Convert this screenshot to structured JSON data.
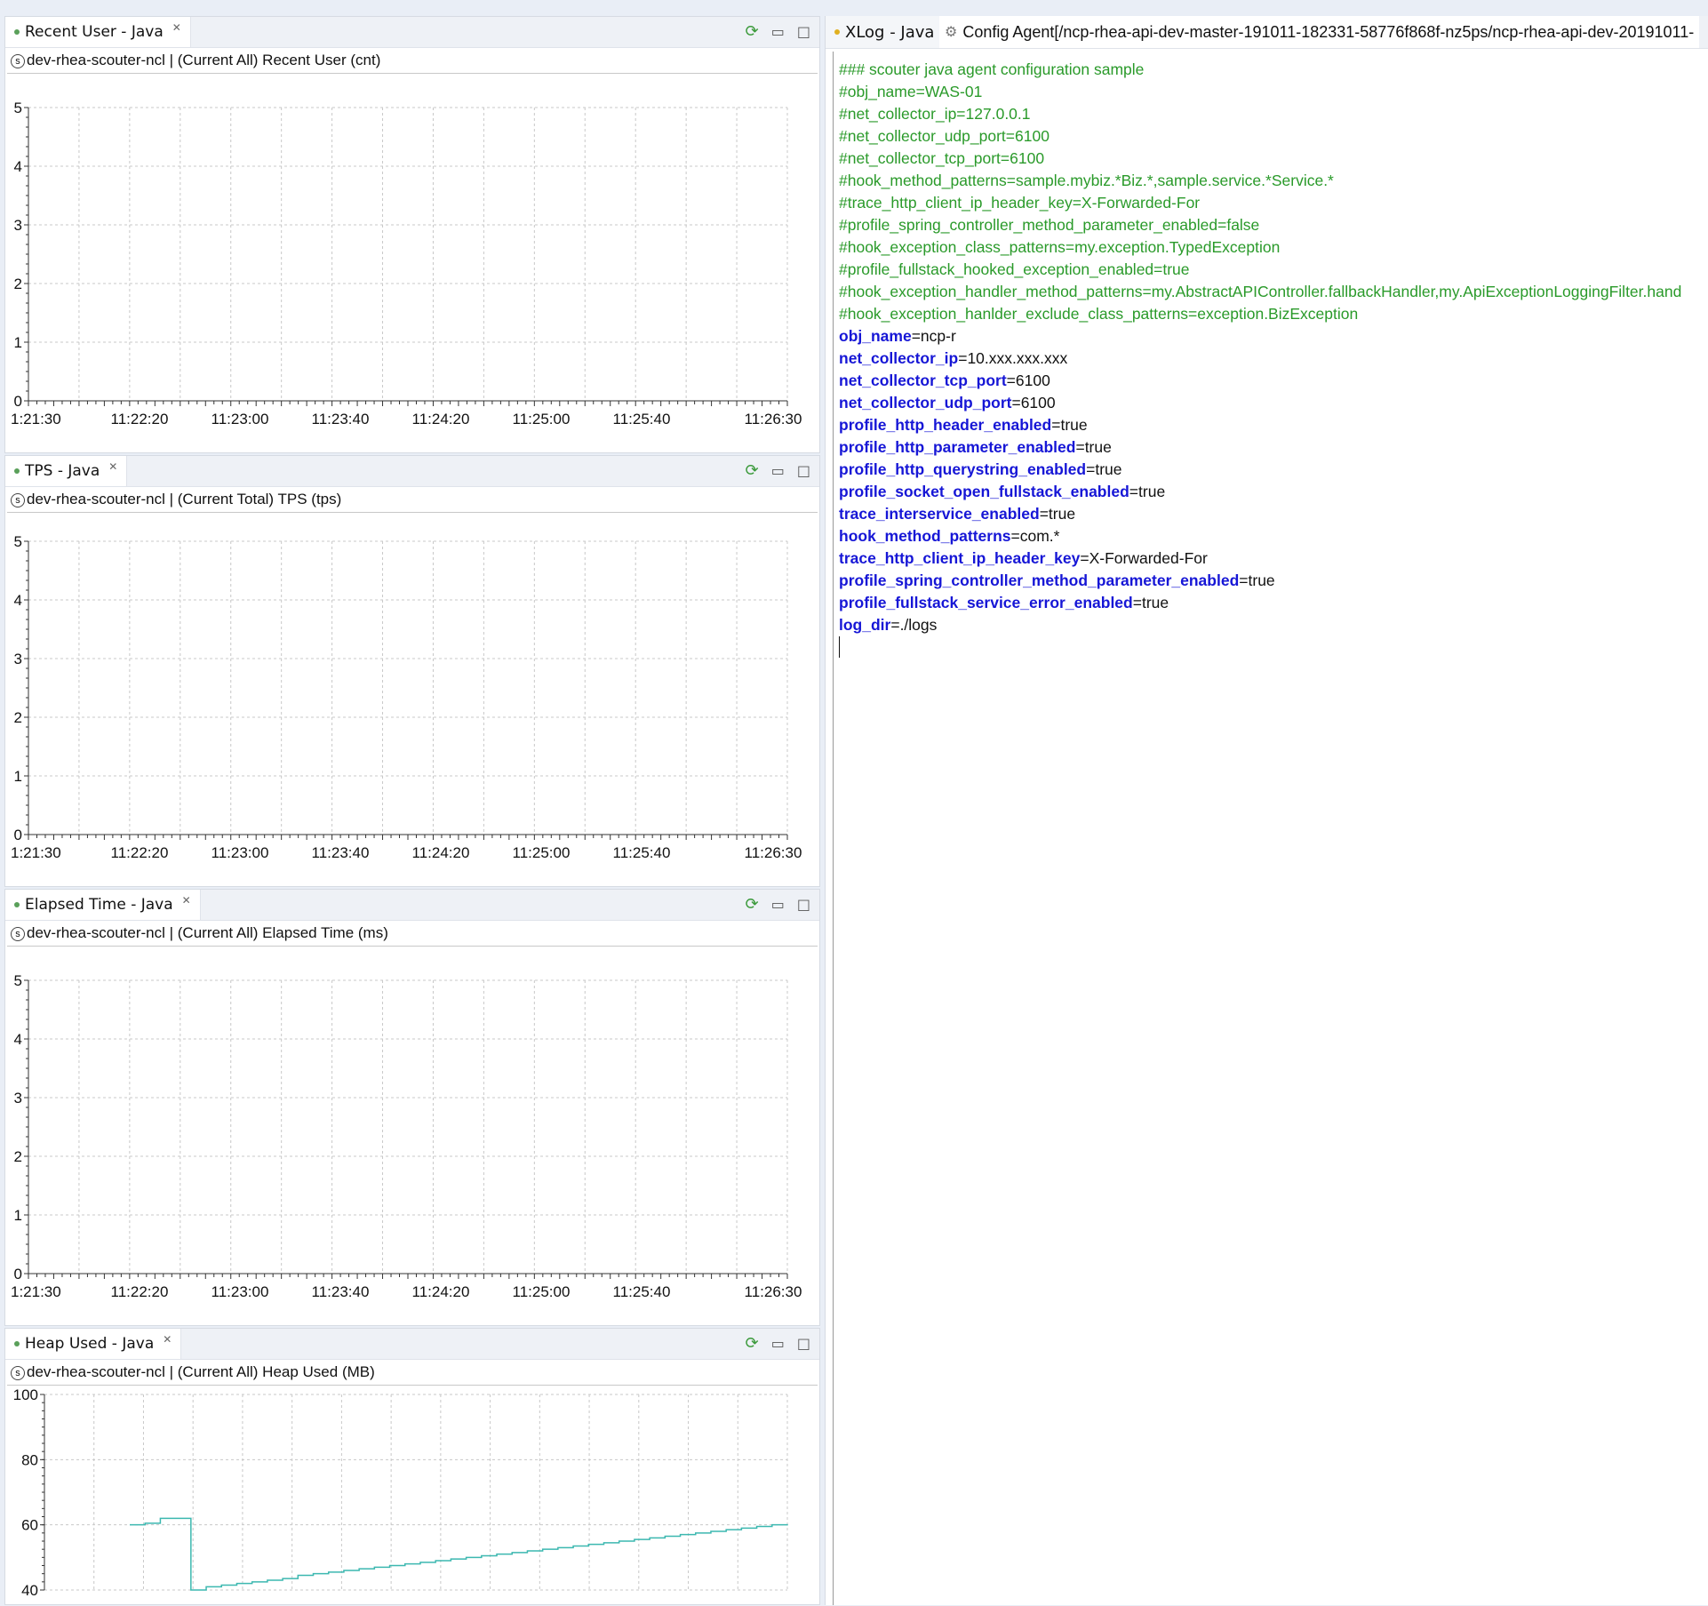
{
  "panels": [
    {
      "tab": "Recent User - Java",
      "subtitle": "dev-rhea-scouter-ncl | (Current All) Recent User (cnt)",
      "yticks": [
        "0",
        "1",
        "2",
        "3",
        "4",
        "5"
      ],
      "xticks": [
        "1:21:30",
        "11:22:20",
        "11:23:00",
        "11:23:40",
        "11:24:20",
        "11:25:00",
        "11:25:40",
        "11:26:30"
      ]
    },
    {
      "tab": "TPS - Java",
      "subtitle": "dev-rhea-scouter-ncl | (Current Total) TPS (tps)",
      "yticks": [
        "0",
        "1",
        "2",
        "3",
        "4",
        "5"
      ],
      "xticks": [
        "1:21:30",
        "11:22:20",
        "11:23:00",
        "11:23:40",
        "11:24:20",
        "11:25:00",
        "11:25:40",
        "11:26:30"
      ]
    },
    {
      "tab": "Elapsed Time - Java",
      "subtitle": "dev-rhea-scouter-ncl | (Current All) Elapsed Time (ms)",
      "yticks": [
        "0",
        "1",
        "2",
        "3",
        "4",
        "5"
      ],
      "xticks": [
        "1:21:30",
        "11:22:20",
        "11:23:00",
        "11:23:40",
        "11:24:20",
        "11:25:00",
        "11:25:40",
        "11:26:30"
      ]
    },
    {
      "tab": "Heap Used - Java",
      "subtitle": "dev-rhea-scouter-ncl | (Current All) Heap Used (MB)",
      "yticks": [
        "40",
        "60",
        "80",
        "100"
      ]
    }
  ],
  "chart_data": [
    {
      "type": "line",
      "title": "(Current All) Recent User (cnt)",
      "ylim": [
        0,
        5
      ],
      "x": [
        "1:21:30",
        "11:22:20",
        "11:23:00",
        "11:23:40",
        "11:24:20",
        "11:25:00",
        "11:25:40",
        "11:26:30"
      ],
      "series": []
    },
    {
      "type": "line",
      "title": "(Current Total) TPS (tps)",
      "ylim": [
        0,
        5
      ],
      "x": [
        "1:21:30",
        "11:22:20",
        "11:23:00",
        "11:23:40",
        "11:24:20",
        "11:25:00",
        "11:25:40",
        "11:26:30"
      ],
      "series": []
    },
    {
      "type": "line",
      "title": "(Current All) Elapsed Time (ms)",
      "ylim": [
        0,
        5
      ],
      "x": [
        "1:21:30",
        "11:22:20",
        "11:23:00",
        "11:23:40",
        "11:24:20",
        "11:25:00",
        "11:25:40",
        "11:26:30"
      ],
      "series": []
    },
    {
      "type": "line",
      "title": "(Current All) Heap Used (MB)",
      "ylim": [
        40,
        100
      ],
      "color": "#3cb8b0",
      "series": [
        {
          "values": [
            60,
            60.5,
            62,
            62,
            40,
            41,
            41.5,
            42,
            42.5,
            43,
            43.5,
            44.5,
            45,
            45.5,
            46,
            46.5,
            47,
            47.5,
            48,
            48.5,
            49,
            49.5,
            50,
            50.5,
            51,
            51.5,
            52,
            52.5,
            53,
            53.5,
            54,
            54.5,
            55,
            55.5,
            56,
            56.5,
            57,
            57.5,
            58,
            58.5,
            59,
            59.5,
            60,
            60.2
          ]
        }
      ]
    }
  ],
  "editor": {
    "tab_xlog": "XLog - Java",
    "tab_config": "Config Agent[/ncp-rhea-api-dev-master-191011-182331-58776f868f-nz5ps/ncp-rhea-api-dev-20191011-",
    "lines": [
      {
        "t": "c",
        "text": "### scouter java agent configuration sample"
      },
      {
        "t": "c",
        "text": "#obj_name=WAS-01"
      },
      {
        "t": "c",
        "text": "#net_collector_ip=127.0.0.1"
      },
      {
        "t": "c",
        "text": "#net_collector_udp_port=6100"
      },
      {
        "t": "c",
        "text": "#net_collector_tcp_port=6100"
      },
      {
        "t": "c",
        "text": "#hook_method_patterns=sample.mybiz.*Biz.*,sample.service.*Service.*"
      },
      {
        "t": "c",
        "text": "#trace_http_client_ip_header_key=X-Forwarded-For"
      },
      {
        "t": "c",
        "text": "#profile_spring_controller_method_parameter_enabled=false"
      },
      {
        "t": "c",
        "text": "#hook_exception_class_patterns=my.exception.TypedException"
      },
      {
        "t": "c",
        "text": "#profile_fullstack_hooked_exception_enabled=true"
      },
      {
        "t": "c",
        "text": "#hook_exception_handler_method_patterns=my.AbstractAPIController.fallbackHandler,my.ApiExceptionLoggingFilter.hand"
      },
      {
        "t": "c",
        "text": "#hook_exception_hanlder_exclude_class_patterns=exception.BizException"
      },
      {
        "t": "kv",
        "key": "obj_name",
        "val": "=ncp-r"
      },
      {
        "t": "kv",
        "key": "net_collector_ip",
        "val": "=10.xxx.xxx.xxx"
      },
      {
        "t": "kv",
        "key": "net_collector_tcp_port",
        "val": "=6100"
      },
      {
        "t": "kv",
        "key": "net_collector_udp_port",
        "val": "=6100"
      },
      {
        "t": "kv",
        "key": "profile_http_header_enabled",
        "val": "=true"
      },
      {
        "t": "kv",
        "key": "profile_http_parameter_enabled",
        "val": "=true"
      },
      {
        "t": "kv",
        "key": "profile_http_querystring_enabled",
        "val": "=true"
      },
      {
        "t": "kv",
        "key": "profile_socket_open_fullstack_enabled",
        "val": "=true"
      },
      {
        "t": "kv",
        "key": "trace_interservice_enabled",
        "val": "=true"
      },
      {
        "t": "kv",
        "key": "hook_method_patterns",
        "val": "=com.*"
      },
      {
        "t": "kv",
        "key": "trace_http_client_ip_header_key",
        "val": "=X-Forwarded-For"
      },
      {
        "t": "kv",
        "key": "profile_spring_controller_method_parameter_enabled",
        "val": "=true"
      },
      {
        "t": "kv",
        "key": "profile_fullstack_service_error_enabled",
        "val": "=true"
      },
      {
        "t": "kv",
        "key": "log_dir",
        "val": "=./logs"
      }
    ]
  },
  "colors": {
    "comment": "#2a9a2a",
    "key": "#1616d6",
    "line": "#3cb8b0"
  }
}
